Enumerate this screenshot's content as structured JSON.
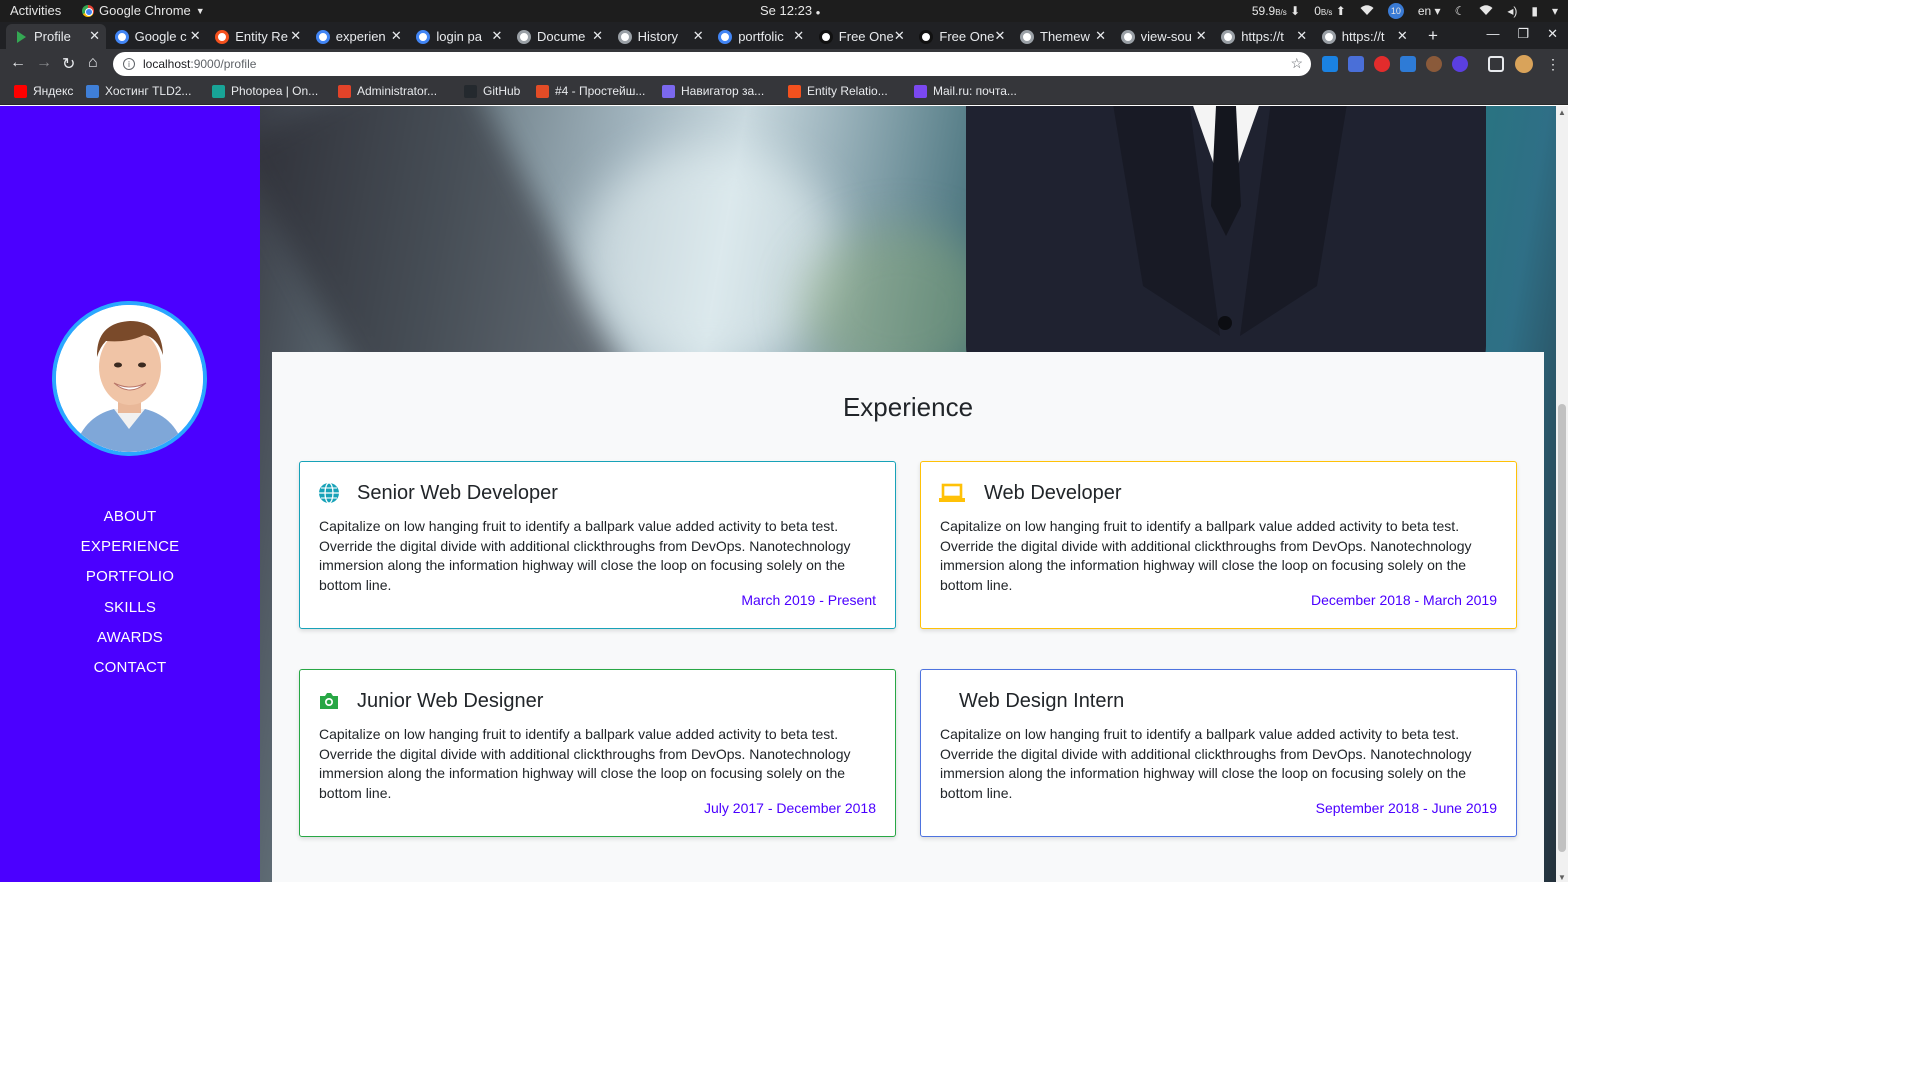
{
  "os": {
    "activities": "Activities",
    "app_name": "Google Chrome",
    "clock": "Se 12:23",
    "net_down": "59.9",
    "net_down_unit": "B/s",
    "net_up": "0",
    "net_up_unit": "B/s",
    "badge": "10",
    "lang": "en"
  },
  "tabs": [
    {
      "title": "Profile",
      "active": true,
      "favicon_color": "#34a853"
    },
    {
      "title": "Google c",
      "active": false,
      "favicon_color": "#4285f4"
    },
    {
      "title": "Entity Re",
      "active": false,
      "favicon_color": "#f4511e"
    },
    {
      "title": "experien",
      "active": false,
      "favicon_color": "#4285f4"
    },
    {
      "title": "login pa",
      "active": false,
      "favicon_color": "#4285f4"
    },
    {
      "title": "Docume",
      "active": false,
      "favicon_color": "#9aa0a6"
    },
    {
      "title": "History",
      "active": false,
      "favicon_color": "#9aa0a6"
    },
    {
      "title": "portfolic",
      "active": false,
      "favicon_color": "#4285f4"
    },
    {
      "title": "Free One",
      "active": false,
      "favicon_color": "#111111"
    },
    {
      "title": "Free One",
      "active": false,
      "favicon_color": "#111111"
    },
    {
      "title": "Themew",
      "active": false,
      "favicon_color": "#9aa0a6"
    },
    {
      "title": "view-sou",
      "active": false,
      "favicon_color": "#9aa0a6"
    },
    {
      "title": "https://t",
      "active": false,
      "favicon_color": "#9aa0a6"
    },
    {
      "title": "https://t",
      "active": false,
      "favicon_color": "#9aa0a6"
    }
  ],
  "toolbar": {
    "url_host": "localhost",
    "url_path": ":9000/profile"
  },
  "bookmarks": [
    {
      "label": "Яндекс",
      "color": "#ff0000"
    },
    {
      "label": "Хостинг TLD2...",
      "color": "#3f7fd8"
    },
    {
      "label": "Photopea | On...",
      "color": "#18a497"
    },
    {
      "label": "Administrator...",
      "color": "#e24329"
    },
    {
      "label": "GitHub",
      "color": "#24292e"
    },
    {
      "label": "#4 - Простейш...",
      "color": "#e34c26"
    },
    {
      "label": "Навигатор за...",
      "color": "#7b68ee"
    },
    {
      "label": "Entity Relatio...",
      "color": "#f4511e"
    },
    {
      "label": "Mail.ru: почта...",
      "color": "#7b48f0"
    }
  ],
  "sidebar": {
    "nav": [
      "ABOUT",
      "EXPERIENCE",
      "PORTFOLIO",
      "SKILLS",
      "AWARDS",
      "CONTACT"
    ]
  },
  "experience": {
    "heading": "Experience",
    "items": [
      {
        "title": "Senior Web Developer",
        "icon": "globe-icon",
        "border_color": "#17a2b8",
        "icon_color": "#17a2b8",
        "text": "Capitalize on low hanging fruit to identify a ballpark value added activity to beta test. Override the digital divide with additional clickthroughs from DevOps. Nanotechnology immersion along the information highway will close the loop on focusing solely on the bottom line.",
        "dates": "March 2019 - Present"
      },
      {
        "title": "Web Developer",
        "icon": "laptop-icon",
        "border_color": "#ffc107",
        "icon_color": "#ffc107",
        "text": "Capitalize on low hanging fruit to identify a ballpark value added activity to beta test. Override the digital divide with additional clickthroughs from DevOps. Nanotechnology immersion along the information highway will close the loop on focusing solely on the bottom line.",
        "dates": "December 2018 - March 2019"
      },
      {
        "title": "Junior Web Designer",
        "icon": "camera-icon",
        "border_color": "#28a745",
        "icon_color": "#28a745",
        "text": "Capitalize on low hanging fruit to identify a ballpark value added activity to beta test. Override the digital divide with additional clickthroughs from DevOps. Nanotechnology immersion along the information highway will close the loop on focusing solely on the bottom line.",
        "dates": "July 2017 - December 2018"
      },
      {
        "title": "Web Design Intern",
        "icon": "",
        "border_color": "#4e73df",
        "icon_color": "#4e73df",
        "text": "Capitalize on low hanging fruit to identify a ballpark value added activity to beta test. Override the digital divide with additional clickthroughs from DevOps. Nanotechnology immersion along the information highway will close the loop on focusing solely on the bottom line.",
        "dates": "September 2018 - June 2019"
      }
    ]
  }
}
